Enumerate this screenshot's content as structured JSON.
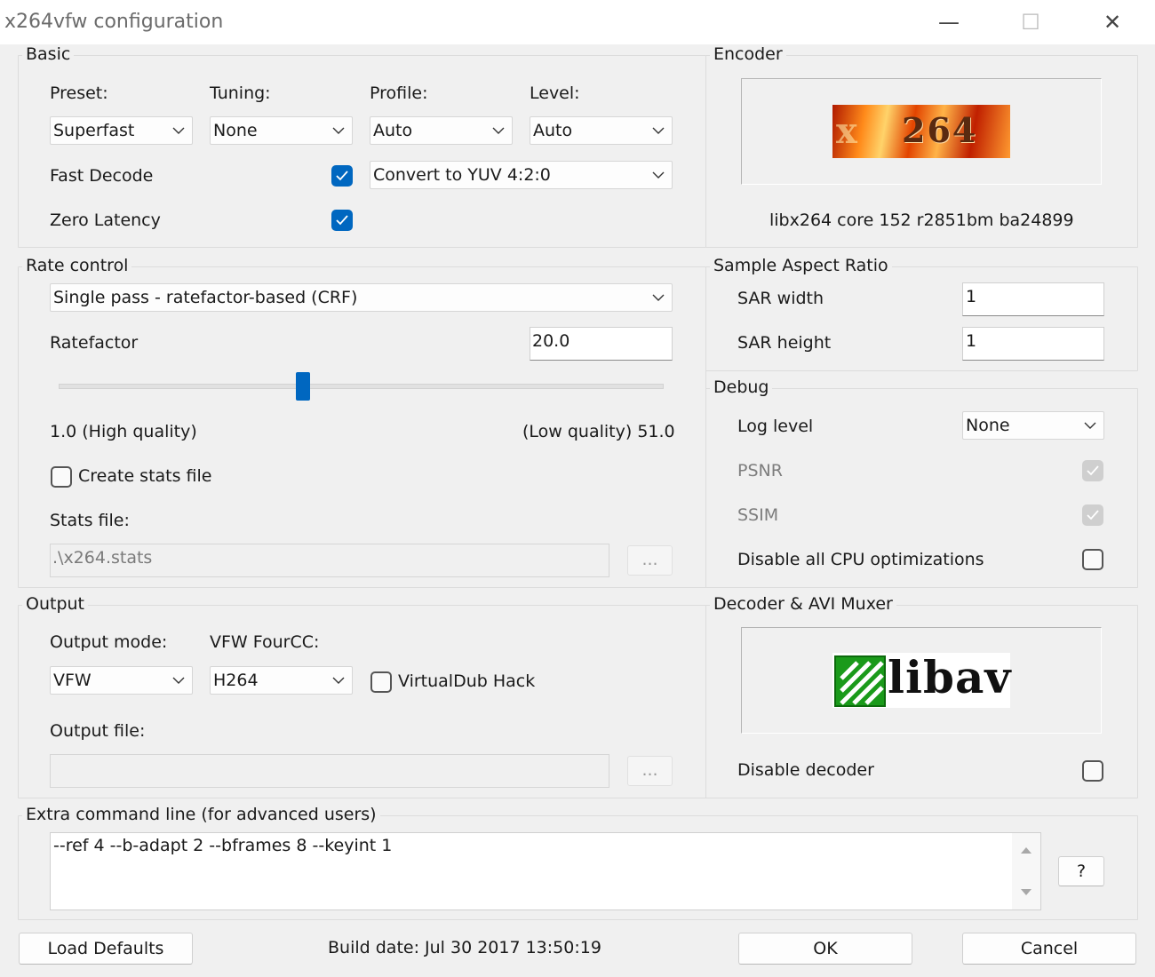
{
  "window": {
    "title": "x264vfw configuration",
    "minimize_glyph": "—",
    "maximize_glyph": "☐",
    "close_glyph": "✕"
  },
  "basic": {
    "group_label": "Basic",
    "preset_label": "Preset:",
    "tuning_label": "Tuning:",
    "profile_label": "Profile:",
    "level_label": "Level:",
    "preset_value": "Superfast",
    "tuning_value": "None",
    "profile_value": "Auto",
    "level_value": "Auto",
    "fast_decode_label": "Fast Decode",
    "fast_decode_checked": true,
    "zero_latency_label": "Zero Latency",
    "zero_latency_checked": true,
    "colorspace_value": "Convert to YUV 4:2:0"
  },
  "encoder": {
    "group_label": "Encoder",
    "logo_text": "264",
    "logo_prefix": "x",
    "version_text": "libx264 core 152 r2851bm ba24899"
  },
  "rate_control": {
    "group_label": "Rate control",
    "mode_value": "Single pass - ratefactor-based (CRF)",
    "ratefactor_label": "Ratefactor",
    "ratefactor_value": "20.0",
    "slider_value": 20.0,
    "slider_min": 1.0,
    "slider_max": 51.0,
    "min_label": "1.0 (High quality)",
    "max_label": "(Low quality) 51.0",
    "create_stats_label": "Create stats file",
    "create_stats_checked": false,
    "stats_file_label": "Stats file:",
    "stats_file_value": ".\\x264.stats",
    "browse_label": "..."
  },
  "sar": {
    "group_label": "Sample Aspect Ratio",
    "width_label": "SAR width",
    "width_value": "1",
    "height_label": "SAR height",
    "height_value": "1"
  },
  "debug": {
    "group_label": "Debug",
    "log_level_label": "Log level",
    "log_level_value": "None",
    "psnr_label": "PSNR",
    "psnr_checked": true,
    "ssim_label": "SSIM",
    "ssim_checked": true,
    "disable_cpu_label": "Disable all CPU optimizations",
    "disable_cpu_checked": false
  },
  "output": {
    "group_label": "Output",
    "mode_label": "Output mode:",
    "fourcc_label": "VFW FourCC:",
    "mode_value": "VFW",
    "fourcc_value": "H264",
    "vdub_hack_label": "VirtualDub Hack",
    "vdub_hack_checked": false,
    "output_file_label": "Output file:",
    "output_file_value": "",
    "browse_label": "..."
  },
  "decoder": {
    "group_label": "Decoder & AVI Muxer",
    "logo_text": "libav",
    "disable_decoder_label": "Disable decoder",
    "disable_decoder_checked": false
  },
  "extra": {
    "group_label": "Extra command line (for advanced users)",
    "value": "--ref 4 --b-adapt 2 --bframes 8 --keyint 1",
    "help_label": "?"
  },
  "footer": {
    "load_defaults_label": "Load Defaults",
    "build_date": "Build date: Jul 30 2017 13:50:19",
    "ok_label": "OK",
    "cancel_label": "Cancel"
  },
  "colors": {
    "accent": "#0067c0",
    "dialog_bg": "#f0f0f0",
    "libav_green": "#1a9a1a"
  }
}
